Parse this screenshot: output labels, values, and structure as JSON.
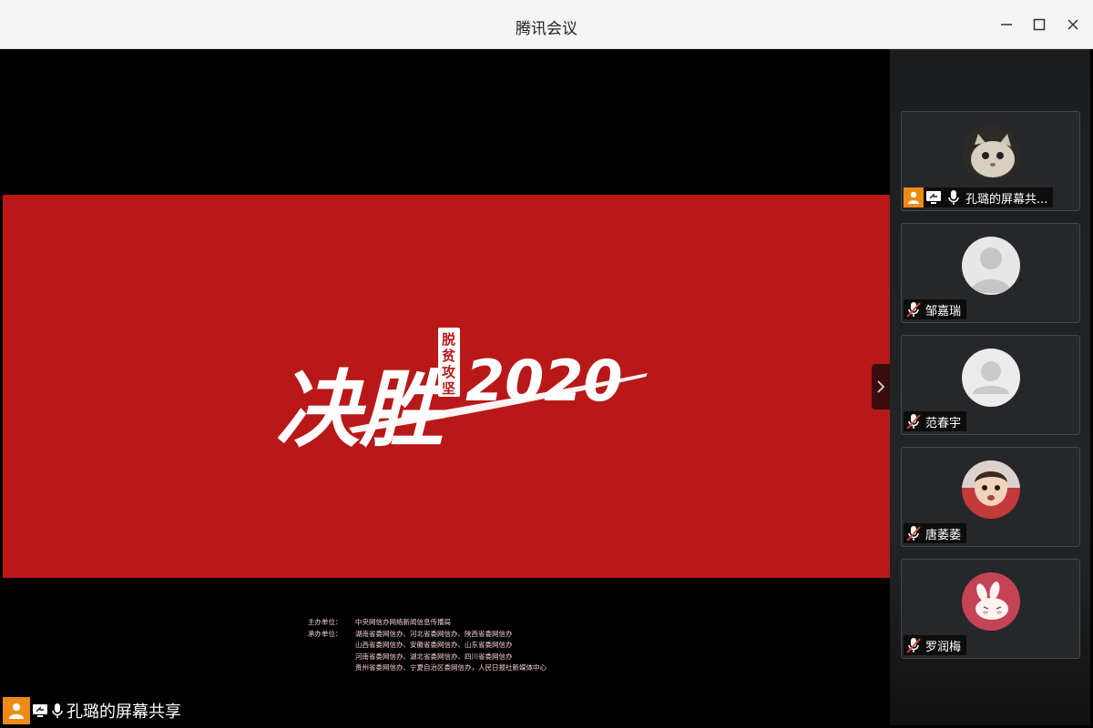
{
  "window": {
    "title": "腾讯会议"
  },
  "titlebar_buttons": {
    "minimize_icon": "minimize-icon",
    "maximize_icon": "maximize-icon",
    "close_icon": "close-icon"
  },
  "slide": {
    "headline": "决胜",
    "year": "2020",
    "seal": "脱贫攻坚",
    "credits": [
      {
        "label": "主办单位：",
        "value": "中央网信办网络新闻信息传播局"
      },
      {
        "label": "承办单位：",
        "value": "湖南省委网信办、河北省委网信办、陕西省委网信办"
      },
      {
        "label": "",
        "value": "山西省委网信办、安徽省委网信办、山东省委网信办"
      },
      {
        "label": "",
        "value": "河南省委网信办、湖北省委网信办、四川省委网信办"
      },
      {
        "label": "",
        "value": "贵州省委网信办、宁夏自治区委网信办，人民日报社新媒体中心"
      }
    ]
  },
  "participants": [
    {
      "name": "孔璐的屏幕共...",
      "host": true,
      "sharing": true,
      "muted": false,
      "avatar": "cat-photo"
    },
    {
      "name": "邹嘉瑞",
      "host": false,
      "sharing": false,
      "muted": true,
      "avatar": "default-person"
    },
    {
      "name": "范春宇",
      "host": false,
      "sharing": false,
      "muted": true,
      "avatar": "default-person"
    },
    {
      "name": "唐萎萎",
      "host": false,
      "sharing": false,
      "muted": true,
      "avatar": "child-photo"
    },
    {
      "name": "罗润梅",
      "host": false,
      "sharing": false,
      "muted": true,
      "avatar": "bunny-cartoon"
    }
  ],
  "bottom": {
    "presenter_label": "孔璐的屏幕共享"
  },
  "colors": {
    "slide_red": "#b81818",
    "host_orange": "#f08a17",
    "muted_red": "#e0403a"
  }
}
